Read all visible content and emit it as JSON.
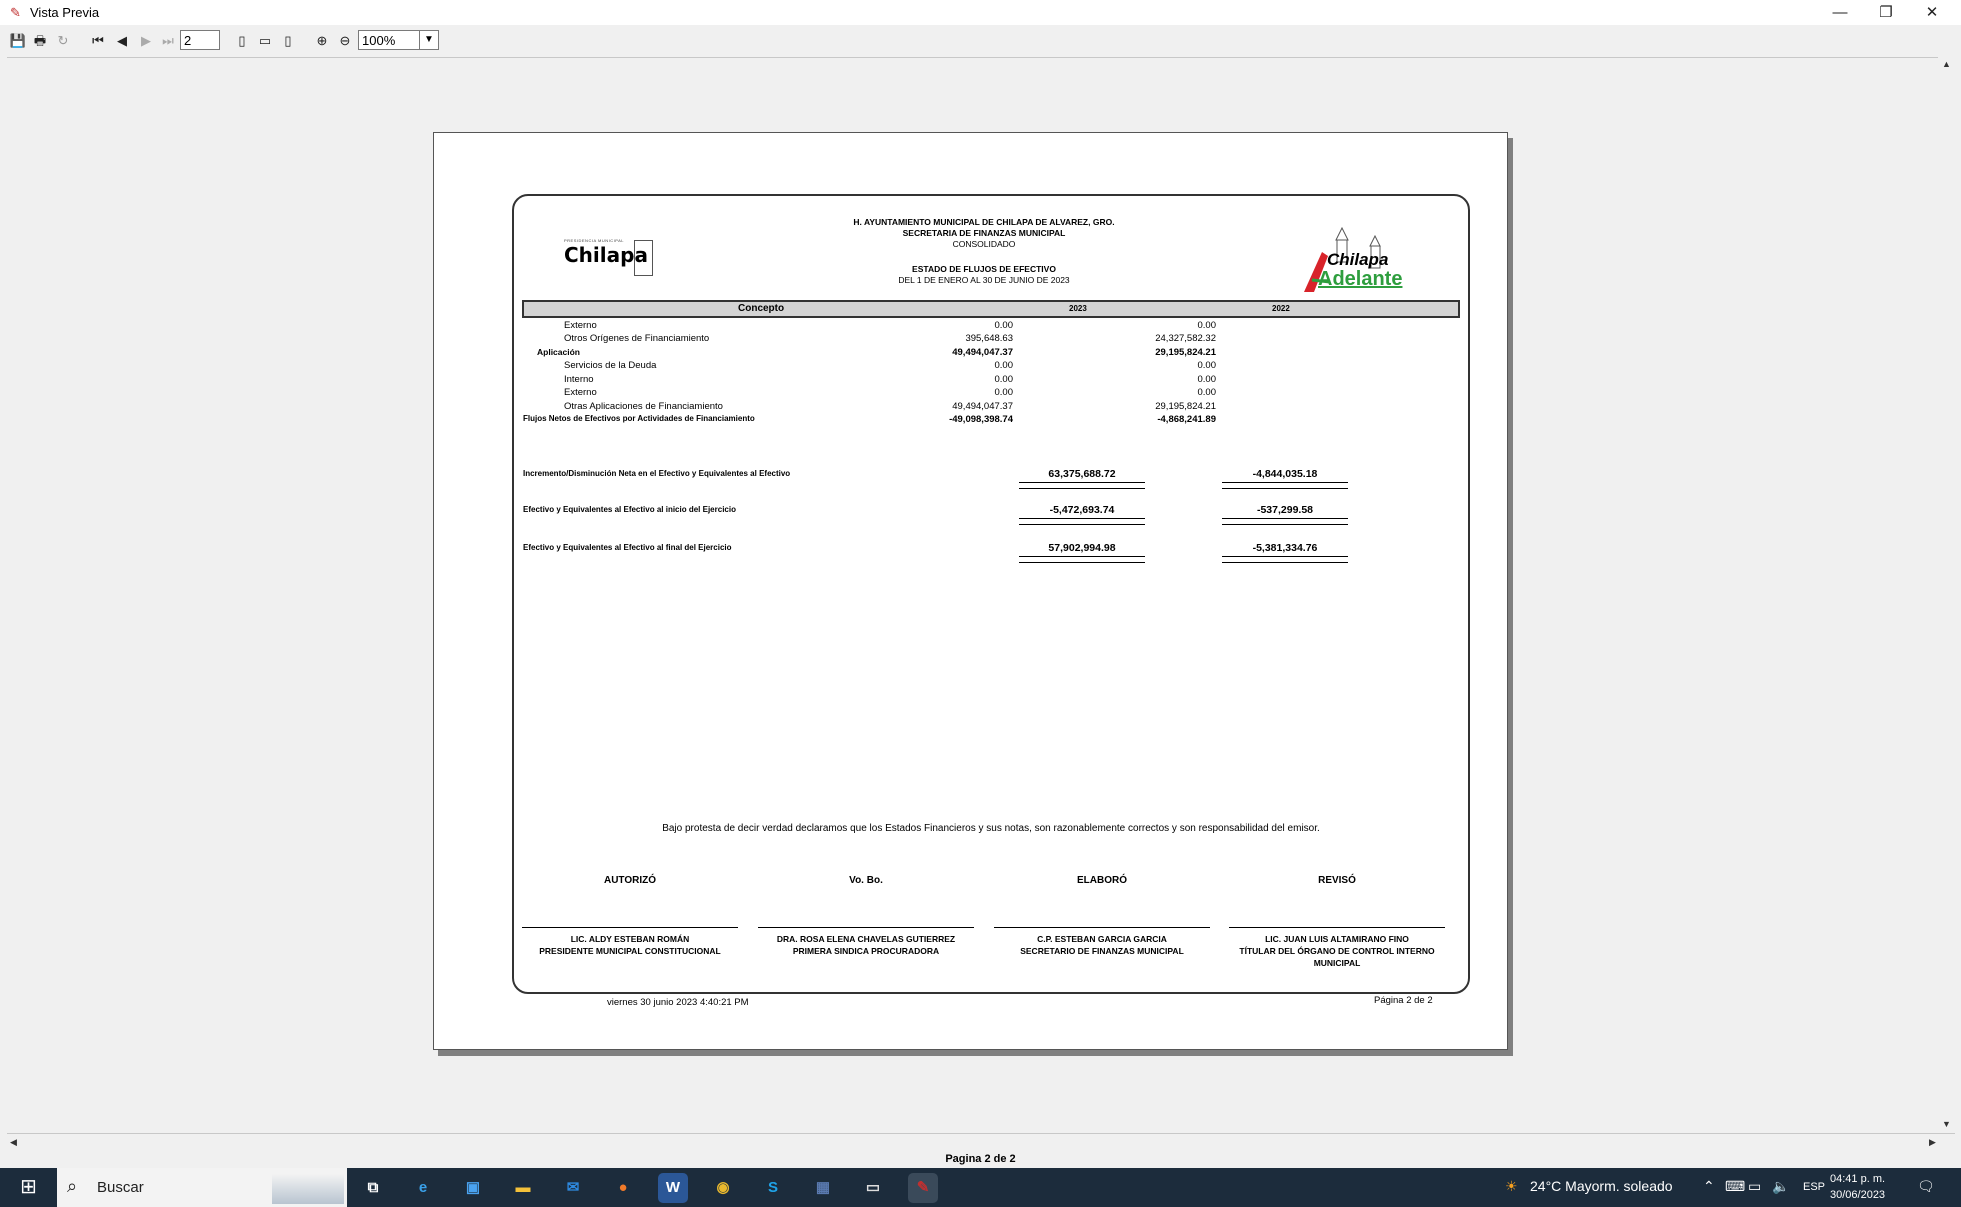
{
  "window": {
    "title": "Vista Previa"
  },
  "toolbar": {
    "page_input": "2",
    "zoom": "100%"
  },
  "statusbar": {
    "text": "Pagina 2 de 2"
  },
  "report": {
    "header": {
      "line1": "H. AYUNTAMIENTO MUNICIPAL DE CHILAPA DE ALVAREZ, GRO.",
      "line2": "SECRETARIA DE FINANZAS MUNICIPAL",
      "line3": "CONSOLIDADO",
      "line4": "ESTADO DE FLUJOS DE EFECTIVO",
      "line5": "DEL 1 DE ENERO AL 30 DE JUNIO DE 2023"
    },
    "logo_left": {
      "small": "PRESIDENCIA MUNICIPAL",
      "name": "Chilapa"
    },
    "logo_right": {
      "line1": "Chilapa",
      "line2": "Adelante"
    },
    "columns": {
      "concepto": "Concepto",
      "y1": "2023",
      "y2": "2022"
    },
    "rows": [
      {
        "label": "Externo",
        "v2023": "0.00",
        "v2022": "0.00"
      },
      {
        "label": "Otros Orígenes de Financiamiento",
        "v2023": "395,648.63",
        "v2022": "24,327,582.32"
      },
      {
        "label": "Aplicación",
        "v2023": "49,494,047.37",
        "v2022": "29,195,824.21"
      },
      {
        "label": "Servicios de la Deuda",
        "v2023": "0.00",
        "v2022": "0.00"
      },
      {
        "label": "Interno",
        "v2023": "0.00",
        "v2022": "0.00"
      },
      {
        "label": "Externo",
        "v2023": "0.00",
        "v2022": "0.00"
      },
      {
        "label": "Otras Aplicaciones de Financiamiento",
        "v2023": "49,494,047.37",
        "v2022": "29,195,824.21"
      },
      {
        "label": "Flujos Netos de Efectivos por Actividades de Financiamiento",
        "v2023": "-49,098,398.74",
        "v2022": "-4,868,241.89"
      }
    ],
    "totals": [
      {
        "label": "Incremento/Disminución Neta en el Efectivo y Equivalentes al Efectivo",
        "v2023": "63,375,688.72",
        "v2022": "-4,844,035.18"
      },
      {
        "label": "Efectivo y Equivalentes al Efectivo al inicio del Ejercicio",
        "v2023": "-5,472,693.74",
        "v2022": "-537,299.58"
      },
      {
        "label": "Efectivo y Equivalentes al Efectivo al final del Ejercicio",
        "v2023": "57,902,994.98",
        "v2022": "-5,381,334.76"
      }
    ],
    "declaration": "Bajo protesta de decir verdad declaramos que los Estados Financieros y sus notas, son razonablemente correctos y son responsabilidad del emisor.",
    "signatures": [
      {
        "role": "AUTORIZÓ",
        "name": "LIC. ALDY ESTEBAN ROMÁN",
        "title": "PRESIDENTE MUNICIPAL CONSTITUCIONAL"
      },
      {
        "role": "Vo. Bo.",
        "name": "DRA. ROSA ELENA CHAVELAS GUTIERREZ",
        "title": "PRIMERA SINDICA PROCURADORA"
      },
      {
        "role": "ELABORÓ",
        "name": "C.P. ESTEBAN GARCIA GARCIA",
        "title": "SECRETARIO DE FINANZAS MUNICIPAL"
      },
      {
        "role": "REVISÓ",
        "name": "LIC. JUAN LUIS ALTAMIRANO FINO",
        "title": "TÍTULAR DEL ÓRGANO DE CONTROL INTERNO MUNICIPAL"
      }
    ],
    "footer": {
      "date": "viernes 30 junio 2023 4:40:21 PM",
      "page": "Página 2 de 2"
    }
  },
  "taskbar": {
    "search_placeholder": "Buscar",
    "weather": "24°C  Mayorm. soleado",
    "language": "ESP",
    "time": "04:41 p. m.",
    "date": "30/06/2023"
  }
}
